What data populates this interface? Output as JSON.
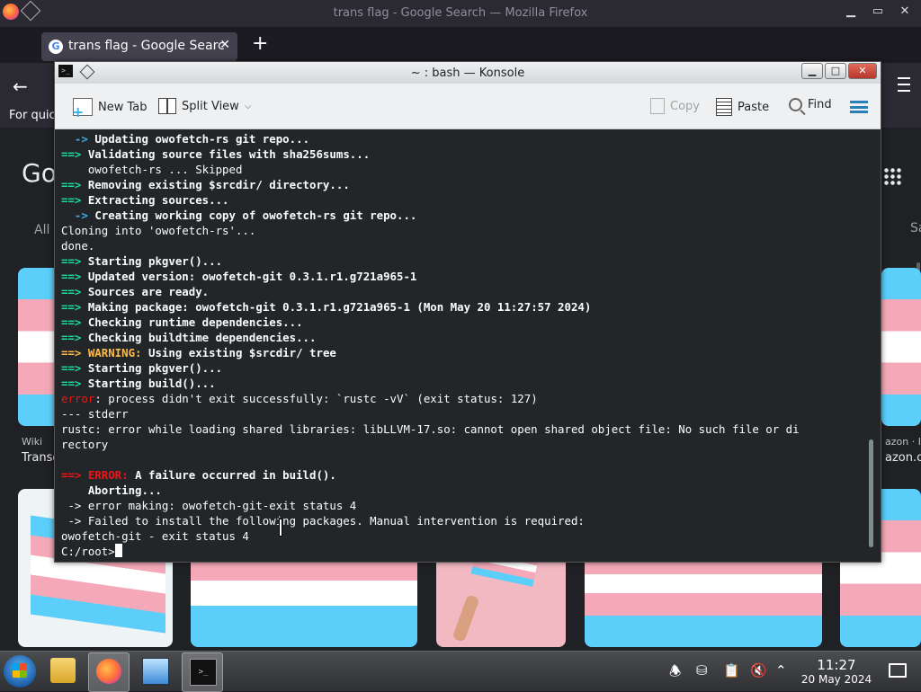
{
  "firefox": {
    "window_title": "trans flag - Google Search — Mozilla Firefox",
    "window_buttons": {
      "minimize": "▁",
      "maximize": "▭",
      "close": "✕"
    },
    "tab": {
      "label": "trans flag - Google Searc",
      "close": "✕"
    },
    "new_tab": "+",
    "bookmark_text": "For quic",
    "google_logo": "Go",
    "search_tab_all": "All",
    "search_tab_right": "Sa",
    "image_results": [
      {
        "source": "Wiki",
        "caption": "Transg"
      },
      {
        "source": "azon · I",
        "caption": "azon.com"
      }
    ]
  },
  "konsole": {
    "title": "~ : bash — Konsole",
    "app_icon_text": ">_",
    "window_buttons": {
      "minimize": "▁",
      "maximize": "□",
      "close": "✕"
    },
    "toolbar": {
      "new_tab": "New Tab",
      "split_view": "Split View",
      "copy": "Copy",
      "paste": "Paste",
      "find": "Find"
    },
    "lines": [
      [
        {
          "t": "  -> ",
          "c": "c-blue"
        },
        {
          "t": "Updating owofetch-rs git repo...",
          "c": "b"
        }
      ],
      [
        {
          "t": "==> ",
          "c": "c-green"
        },
        {
          "t": "Validating source files with sha256sums...",
          "c": "b"
        }
      ],
      [
        {
          "t": "    owofetch-rs ... Skipped",
          "c": ""
        }
      ],
      [
        {
          "t": "==> ",
          "c": "c-green"
        },
        {
          "t": "Removing existing $srcdir/ directory...",
          "c": "b"
        }
      ],
      [
        {
          "t": "==> ",
          "c": "c-green"
        },
        {
          "t": "Extracting sources...",
          "c": "b"
        }
      ],
      [
        {
          "t": "  -> ",
          "c": "c-blue"
        },
        {
          "t": "Creating working copy of owofetch-rs git repo...",
          "c": "b"
        }
      ],
      [
        {
          "t": "Cloning into 'owofetch-rs'...",
          "c": ""
        }
      ],
      [
        {
          "t": "done.",
          "c": ""
        }
      ],
      [
        {
          "t": "==> ",
          "c": "c-green"
        },
        {
          "t": "Starting pkgver()...",
          "c": "b"
        }
      ],
      [
        {
          "t": "==> ",
          "c": "c-green"
        },
        {
          "t": "Updated version: owofetch-git 0.3.1.r1.g721a965-1",
          "c": "b"
        }
      ],
      [
        {
          "t": "==> ",
          "c": "c-green"
        },
        {
          "t": "Sources are ready.",
          "c": "b"
        }
      ],
      [
        {
          "t": "==> ",
          "c": "c-green"
        },
        {
          "t": "Making package: owofetch-git 0.3.1.r1.g721a965-1 (Mon May 20 11:27:57 2024)",
          "c": "b"
        }
      ],
      [
        {
          "t": "==> ",
          "c": "c-green"
        },
        {
          "t": "Checking runtime dependencies...",
          "c": "b"
        }
      ],
      [
        {
          "t": "==> ",
          "c": "c-green"
        },
        {
          "t": "Checking buildtime dependencies...",
          "c": "b"
        }
      ],
      [
        {
          "t": "==> ",
          "c": "c-yellow"
        },
        {
          "t": "WARNING: ",
          "c": "c-yellow"
        },
        {
          "t": "Using existing $srcdir/ tree",
          "c": "b"
        }
      ],
      [
        {
          "t": "==> ",
          "c": "c-green"
        },
        {
          "t": "Starting pkgver()...",
          "c": "b"
        }
      ],
      [
        {
          "t": "==> ",
          "c": "c-green"
        },
        {
          "t": "Starting build()...",
          "c": "b"
        }
      ],
      [
        {
          "t": "error",
          "c": "c-red"
        },
        {
          "t": ": process didn't exit successfully: `rustc -vV` (exit status: 127)",
          "c": ""
        }
      ],
      [
        {
          "t": "--- stderr",
          "c": ""
        }
      ],
      [
        {
          "t": "rustc: error while loading shared libraries: libLLVM-17.so: cannot open shared object file: No such file or di",
          "c": ""
        }
      ],
      [
        {
          "t": "rectory",
          "c": ""
        }
      ],
      [
        {
          "t": "",
          "c": ""
        }
      ],
      [
        {
          "t": "==> ",
          "c": "c-redb"
        },
        {
          "t": "ERROR: ",
          "c": "c-redb"
        },
        {
          "t": "A failure occurred in build().",
          "c": "b"
        }
      ],
      [
        {
          "t": "    Aborting...",
          "c": "b"
        }
      ],
      [
        {
          "t": " -> error making: owofetch-git-exit status 4",
          "c": ""
        }
      ],
      [
        {
          "t": " -> Failed to install the following packages. Manual intervention is required:",
          "c": ""
        }
      ],
      [
        {
          "t": "owofetch-git - exit status 4",
          "c": ""
        }
      ],
      [
        {
          "t": "C:/root>",
          "c": ""
        }
      ]
    ]
  },
  "taskbar": {
    "terminal_icon_text": ">_",
    "clock": {
      "time": "11:27",
      "date": "20 May 2024"
    }
  }
}
